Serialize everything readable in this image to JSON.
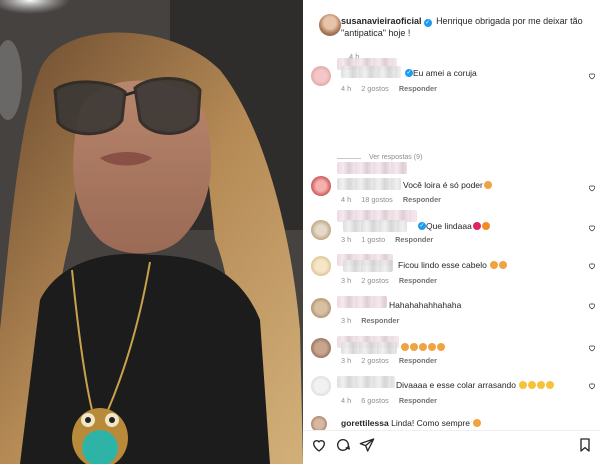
{
  "post": {
    "author": "susanavieiraoficial",
    "caption": "Henrique obrigada por me deixar tão \"antipatica\" hoje !",
    "time": "4 h"
  },
  "see_replies": "Ver respostas (9)",
  "comments": [
    {
      "text": "Eu amei a coruja",
      "time": "4 h",
      "likes": "2 gostos",
      "reply": "Responder",
      "verified": true
    },
    {
      "text": "Você loira é só poder",
      "time": "4 h",
      "likes": "18 gostos",
      "reply": "Responder"
    },
    {
      "text": "Que lindaaa",
      "time": "3 h",
      "likes": "1 gosto",
      "reply": "Responder",
      "verified": true
    },
    {
      "text": "Ficou lindo esse cabelo",
      "time": "3 h",
      "likes": "2 gostos",
      "reply": "Responder"
    },
    {
      "text": "Hahahahahhahaha",
      "time": "3 h",
      "likes": "",
      "reply": "Responder"
    },
    {
      "text": "",
      "time": "3 h",
      "likes": "2 gostos",
      "reply": "Responder"
    },
    {
      "text": "Divaaaa e esse colar arrasando",
      "time": "4 h",
      "likes": "6 gostos",
      "reply": "Responder"
    },
    {
      "author": "gorettilessa",
      "text": "Linda! Como sempre"
    }
  ],
  "icons": [
    "heart-icon",
    "comment-icon",
    "share-icon",
    "bookmark-icon"
  ],
  "colors": {
    "verified": "#1d9bf0",
    "meta": "#8e8e8e",
    "text": "#262626"
  }
}
